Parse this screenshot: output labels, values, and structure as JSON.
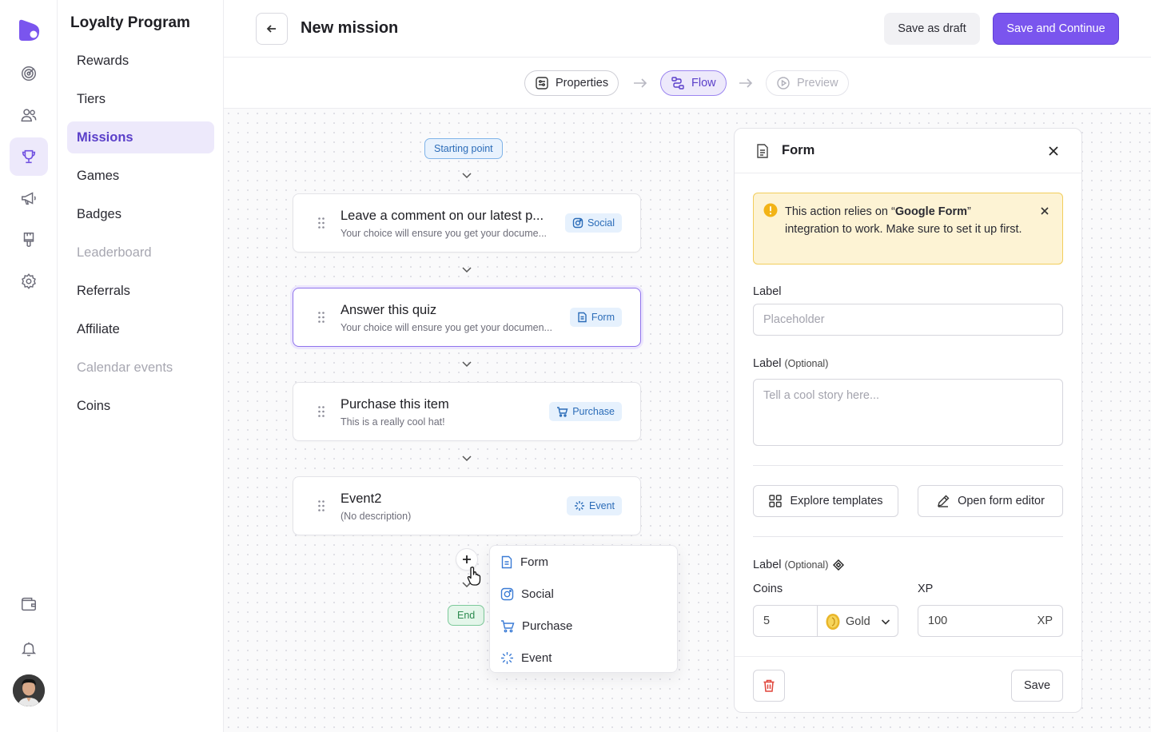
{
  "sidebar": {
    "title": "Loyalty Program",
    "items": [
      {
        "label": "Rewards",
        "state": "normal"
      },
      {
        "label": "Tiers",
        "state": "normal"
      },
      {
        "label": "Missions",
        "state": "active"
      },
      {
        "label": "Games",
        "state": "normal"
      },
      {
        "label": "Badges",
        "state": "normal"
      },
      {
        "label": "Leaderboard",
        "state": "disabled"
      },
      {
        "label": "Referrals",
        "state": "normal"
      },
      {
        "label": "Affiliate",
        "state": "normal"
      },
      {
        "label": "Calendar events",
        "state": "disabled"
      },
      {
        "label": "Coins",
        "state": "normal"
      }
    ]
  },
  "rail": {
    "icons": [
      "logo",
      "radar-icon",
      "users-icon",
      "trophy-icon",
      "megaphone-icon",
      "paint-brush-icon",
      "gear-icon",
      "wallet-icon",
      "bell-icon",
      "avatar"
    ],
    "active": "trophy-icon"
  },
  "header": {
    "title": "New mission",
    "draft_label": "Save as draft",
    "primary_label": "Save and Continue"
  },
  "stepper": {
    "steps": [
      {
        "label": "Properties",
        "state": "done"
      },
      {
        "label": "Flow",
        "state": "active"
      },
      {
        "label": "Preview",
        "state": "upcoming"
      }
    ]
  },
  "flow": {
    "start_label": "Starting point",
    "end_label": "End",
    "cards": [
      {
        "title": "Leave a comment on our latest p...",
        "description": "Your choice will ensure you get your docume...",
        "badge": "Social",
        "badge_icon": "instagram-icon",
        "selected": false
      },
      {
        "title": "Answer this quiz",
        "description": "Your choice will ensure you get your documen...",
        "badge": "Form",
        "badge_icon": "form-icon",
        "selected": true
      },
      {
        "title": "Purchase this item",
        "description": "This is a really cool hat!",
        "badge": "Purchase",
        "badge_icon": "cart-icon",
        "selected": false
      },
      {
        "title": "Event2",
        "description": "(No description)",
        "badge": "Event",
        "badge_icon": "event-icon",
        "selected": false
      }
    ],
    "add_menu": {
      "items": [
        {
          "label": "Form",
          "icon": "form-icon"
        },
        {
          "label": "Social",
          "icon": "instagram-icon"
        },
        {
          "label": "Purchase",
          "icon": "cart-icon"
        },
        {
          "label": "Event",
          "icon": "event-icon"
        }
      ]
    }
  },
  "panel": {
    "title": "Form",
    "alert": {
      "prefix": "This action relies on “",
      "strong": "Google Form",
      "suffix": "” integration to work. Make sure to set it up first."
    },
    "label_1": "Label",
    "label_1_placeholder": "Placeholder",
    "label_2": "Label",
    "label_2_optional": "(Optional)",
    "label_2_placeholder": "Tell a cool story here...",
    "explore_label": "Explore templates",
    "editor_label": "Open form editor",
    "label_3": "Label",
    "label_3_optional": "(Optional)",
    "coins_label": "Coins",
    "coins_value": "5",
    "currency": "Gold",
    "xp_label": "XP",
    "xp_value": "100",
    "xp_suffix": "XP",
    "save_label": "Save"
  },
  "colors": {
    "accent": "#7a55ee",
    "accent_soft": "#ede9fb",
    "info_blue": "#2b6cb8",
    "warning_bg": "#fdf3d4",
    "success": "#2c8a4f",
    "danger": "#e0453a"
  }
}
